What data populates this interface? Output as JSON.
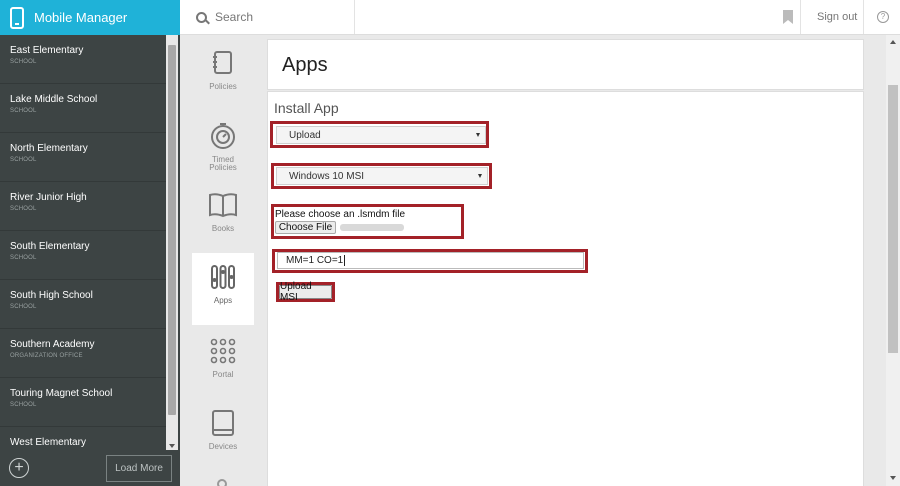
{
  "app": {
    "title": "Mobile Manager"
  },
  "topbar": {
    "search_placeholder": "Search",
    "signout_label": "Sign out",
    "help_symbol": "?"
  },
  "sidebar": {
    "schools": [
      {
        "name": "East Elementary",
        "type": "SCHOOL"
      },
      {
        "name": "Lake Middle School",
        "type": "SCHOOL"
      },
      {
        "name": "North Elementary",
        "type": "SCHOOL"
      },
      {
        "name": "River Junior High",
        "type": "SCHOOL"
      },
      {
        "name": "South Elementary",
        "type": "SCHOOL"
      },
      {
        "name": "South High School",
        "type": "SCHOOL"
      },
      {
        "name": "Southern Academy",
        "type": "ORGANIZATION OFFICE"
      },
      {
        "name": "Touring Magnet School",
        "type": "SCHOOL"
      },
      {
        "name": "West Elementary",
        "type": ""
      }
    ],
    "add_symbol": "+",
    "load_more_label": "Load More"
  },
  "nav": {
    "items": [
      {
        "label": "Policies",
        "icon": "policies-icon"
      },
      {
        "label": "Timed Policies",
        "icon": "timer-icon"
      },
      {
        "label": "Books",
        "icon": "book-icon"
      },
      {
        "label": "Apps",
        "icon": "apps-sliders-icon",
        "active": true
      },
      {
        "label": "Portal",
        "icon": "grid-dots-icon"
      },
      {
        "label": "Devices",
        "icon": "tablet-icon"
      }
    ]
  },
  "main": {
    "page_title": "Apps",
    "install_title": "Install App",
    "source_select": "Upload",
    "platform_select": "Windows 10 MSI",
    "choose_file_label": "Please choose an .lsmdm file",
    "choose_file_button": "Choose File",
    "args_value": "MM=1 CO=1",
    "upload_button": "Upload MSI"
  },
  "colors": {
    "brand": "#1fb2d8",
    "sidebar": "#3d4444",
    "highlight_box": "#a32128"
  }
}
